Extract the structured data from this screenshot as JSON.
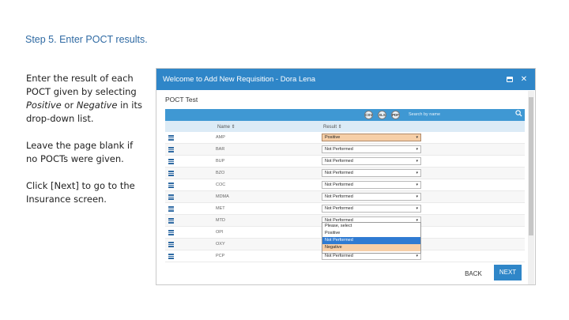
{
  "slide": {
    "title": "Step 5. Enter POCT results.",
    "instructions": [
      {
        "parts": [
          "Enter the result of each POCT given by selecting ",
          "Positive",
          " or ",
          "Negative",
          " in its drop-down list."
        ]
      },
      {
        "text": "Leave the page blank if no POCTs were given."
      },
      {
        "text": "Click [Next] to go to the Insurance screen."
      }
    ]
  },
  "modal": {
    "title": "Welcome to Add New Requisition - Dora Lena",
    "panel_title": "POCT Test",
    "toolbar": {
      "icons": [
        {
          "name": "csv-export-icon",
          "label": "CSV"
        },
        {
          "name": "xls-export-icon",
          "label": "XLS"
        },
        {
          "name": "pdf-export-icon",
          "label": "PDF"
        }
      ],
      "search_placeholder": "Search by name",
      "search_icon": "magnifier-icon"
    },
    "columns": {
      "name": "Name ⇕",
      "result": "Result ⇕"
    },
    "rows": [
      {
        "name": "AMP",
        "result": "Positive",
        "highlight": true
      },
      {
        "name": "BAR",
        "result": "Not Performed"
      },
      {
        "name": "BUP",
        "result": "Not Performed"
      },
      {
        "name": "BZO",
        "result": "Not Performed"
      },
      {
        "name": "COC",
        "result": "Not Performed"
      },
      {
        "name": "MDMA",
        "result": "Not Performed"
      },
      {
        "name": "MET",
        "result": "Not Performed"
      },
      {
        "name": "MTD",
        "result": "Not Performed"
      },
      {
        "name": "OPI",
        "result": "Not Performed"
      },
      {
        "name": "OXY",
        "result": "Not Performed"
      },
      {
        "name": "PCP",
        "result": "Not Performed"
      }
    ],
    "dropdown": {
      "options": [
        "Please, select",
        "Positive",
        "Not Performed",
        "Negative"
      ],
      "selected": "Not Performed",
      "highlighted": "Negative"
    },
    "footer": {
      "back_label": "BACK",
      "next_label": "NEXT"
    }
  }
}
